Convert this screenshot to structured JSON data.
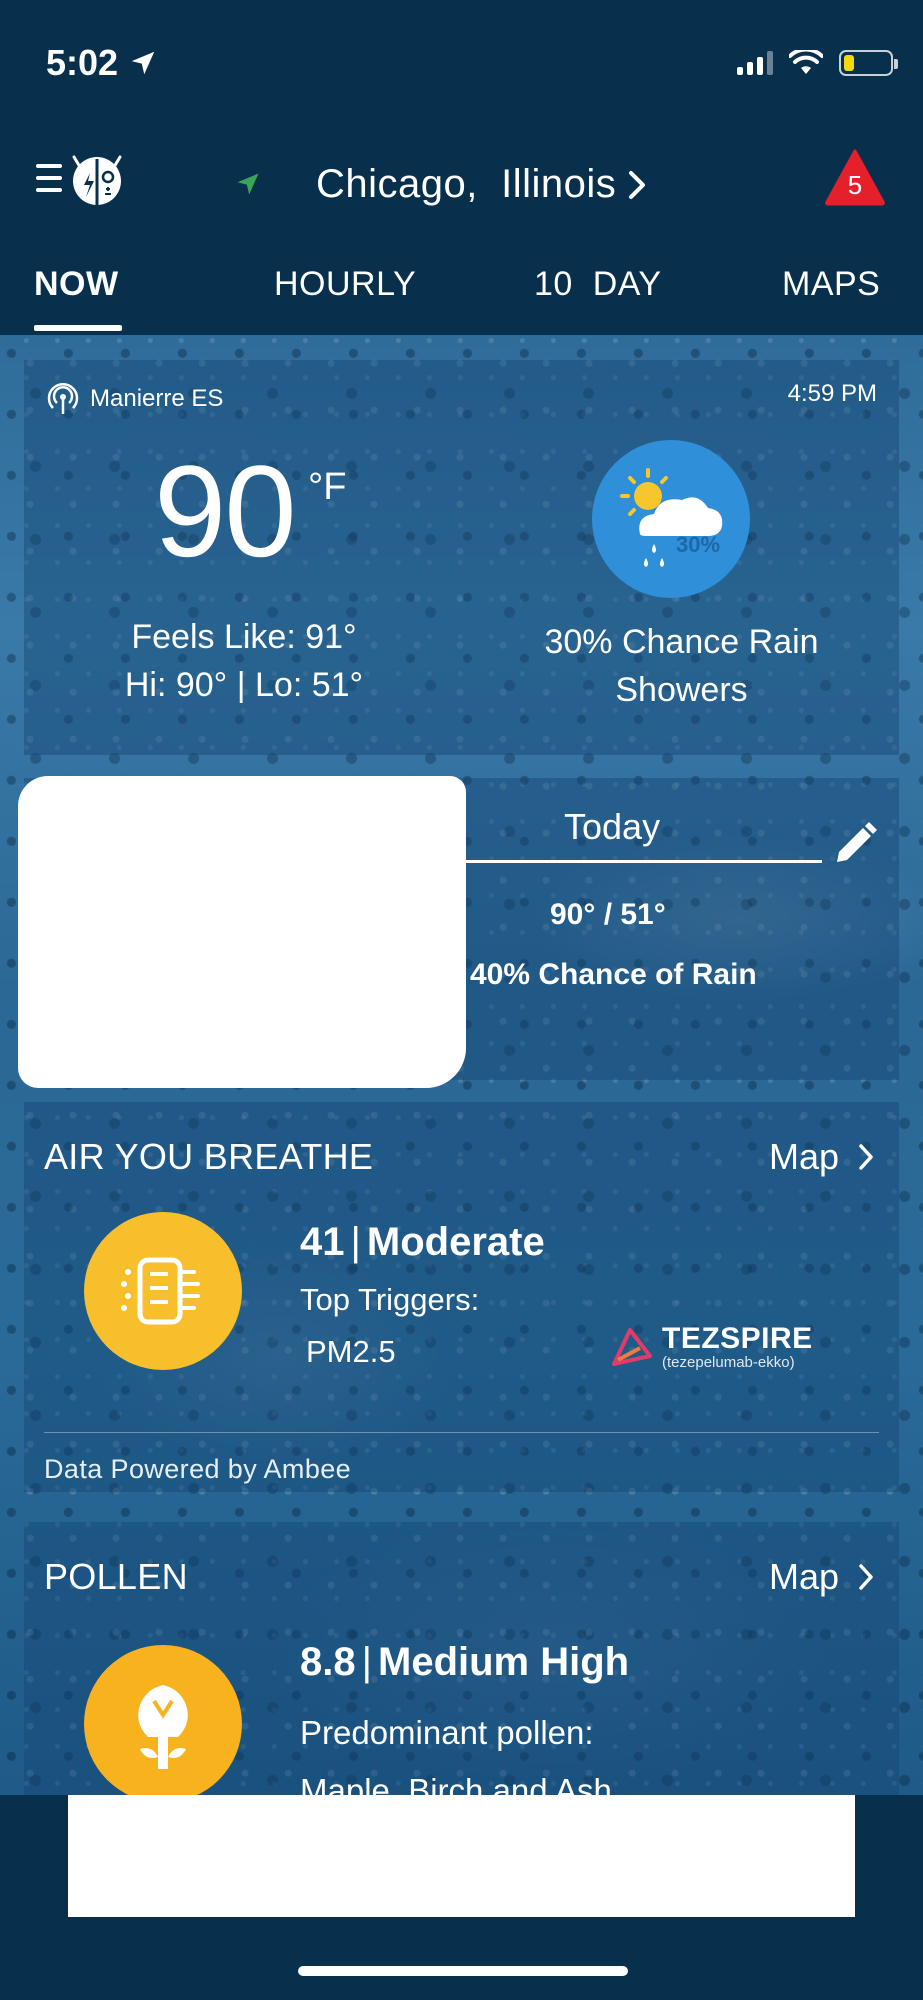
{
  "status": {
    "time": "5:02"
  },
  "header": {
    "location": "Chicago,  Illinois",
    "alert_count": "5"
  },
  "tabs": [
    "NOW",
    "HOURLY",
    "10  DAY",
    "MAPS"
  ],
  "current": {
    "station": "Manierre ES",
    "obs_time": "4:59 PM",
    "temperature": "90",
    "unit": "°F",
    "feels_like": "Feels Like: 91°",
    "hi_lo": "Hi: 90° | Lo: 51°",
    "icon": "sun-cloud-rain-icon",
    "icon_pct": "30%",
    "condition_line1": "30% Chance Rain",
    "condition_line2": "Showers"
  },
  "daily": {
    "day": "Today",
    "temps": "90° / 51°",
    "rain": "40% Chance of Rain"
  },
  "air": {
    "title": "AIR YOU BREATHE",
    "map_label": "Map",
    "aqi": "41",
    "level": "Moderate",
    "triggers_label": "Top Triggers:",
    "trigger": "PM2.5",
    "ad_brand": "TEZSPIRE",
    "ad_sub": "(tezepelumab-ekko)",
    "powered_by": "Data Powered by Ambee"
  },
  "pollen": {
    "title": "POLLEN",
    "map_label": "Map",
    "index": "8.8",
    "level": "Medium High",
    "label": "Predominant pollen:",
    "species": "Maple, Birch and Ash"
  },
  "colors": {
    "app_bg": "#08304c",
    "air_icon_bg": "#f7bf2c",
    "pollen_icon_bg": "#f7b21e",
    "weather_icon_bg": "#2f8fd9",
    "alert_red": "#e5202a"
  }
}
